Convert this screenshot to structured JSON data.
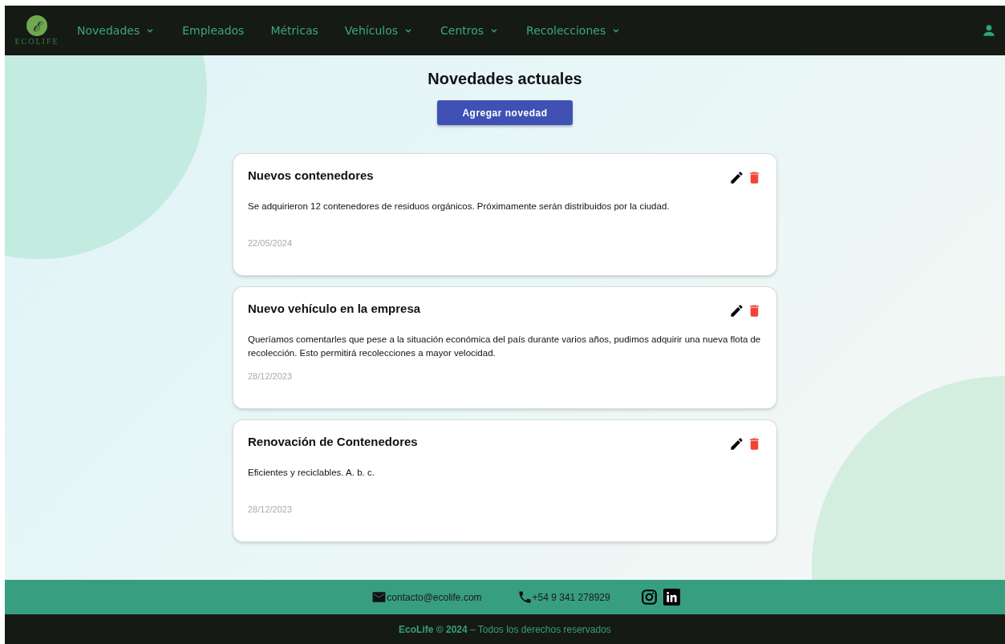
{
  "navbar": {
    "logo_letter": "ℰ",
    "logo_text": "ECOLIFE",
    "items": [
      {
        "label": "Novedades",
        "dropdown": true
      },
      {
        "label": "Empleados",
        "dropdown": false
      },
      {
        "label": "Métricas",
        "dropdown": false
      },
      {
        "label": "Vehículos",
        "dropdown": true
      },
      {
        "label": "Centros",
        "dropdown": true
      },
      {
        "label": "Recolecciones",
        "dropdown": true
      }
    ]
  },
  "page": {
    "title": "Novedades actuales",
    "add_button": "Agregar novedad"
  },
  "news": [
    {
      "title": "Nuevos contenedores",
      "body": "Se adquirieron 12 contenedores de residuos orgánicos. Próximamente serán distribuidos por la ciudad.",
      "date": "22/05/2024"
    },
    {
      "title": "Nuevo vehículo en la empresa",
      "body": "Queríamos comentarles que pese a la situación económica del país durante varios años, pudimos adquirir una nueva flota de recolección. Esto permitirá recolecciones a mayor velocidad.",
      "date": "28/12/2023"
    },
    {
      "title": "Renovación de Contenedores",
      "body": "Eficientes y reciclables. A. b. c.",
      "date": "28/12/2023"
    }
  ],
  "footer": {
    "email": "contacto@ecolife.com",
    "phone": "+54 9 341 278929",
    "copyright": "**EcoLife © 2024** – Todos los derechos reservados"
  }
}
